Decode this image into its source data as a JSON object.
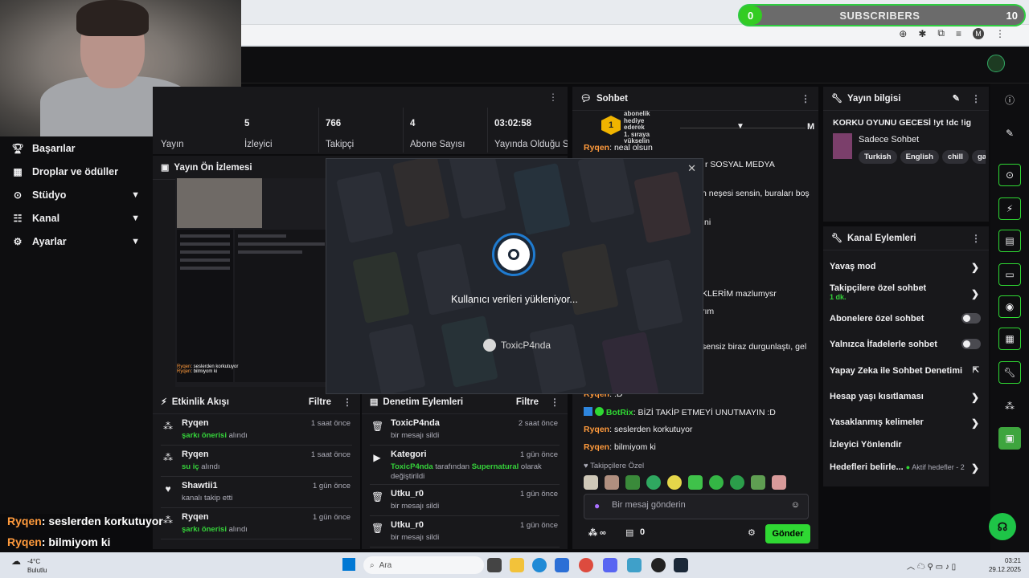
{
  "subscribers": {
    "current": "0",
    "label": "SUBSCRIBERS",
    "goal": "10",
    "progress_percent": 0,
    "accent": "#33cc22"
  },
  "sidebar": {
    "items": [
      {
        "label": "Başarılar",
        "icon": "trophy-icon",
        "chevron": false
      },
      {
        "label": "Droplar ve ödüller",
        "icon": "gift-icon",
        "chevron": false
      },
      {
        "label": "Stüdyo",
        "icon": "studio-icon",
        "chevron": true
      },
      {
        "label": "Kanal",
        "icon": "channel-icon",
        "chevron": true
      },
      {
        "label": "Ayarlar",
        "icon": "gear-icon",
        "chevron": true
      }
    ]
  },
  "stats": {
    "first_label": "Yayın",
    "items": [
      {
        "value": "5",
        "label": "İzleyici"
      },
      {
        "value": "766",
        "label": "Takipçi"
      },
      {
        "value": "4",
        "label": "Abone Sayısı"
      },
      {
        "value": "03:02:58",
        "label": "Yayında Olduğu Süre"
      }
    ]
  },
  "preview": {
    "title": "Yayın Ön İzlemesi"
  },
  "modal": {
    "loading_text": "Kullanıcı verileri yükleniyor...",
    "username": "ToxicP4nda"
  },
  "activity": {
    "title": "Etkinlik Akışı",
    "filter": "Filtre",
    "items": [
      {
        "icon": "bits-icon",
        "user": "Ryqen",
        "highlight": "şarkı önerisi",
        "rest": " alındı",
        "time": "1 saat önce"
      },
      {
        "icon": "bits-icon",
        "user": "Ryqen",
        "highlight": "su iç",
        "rest": " alındı",
        "time": "1 saat önce"
      },
      {
        "icon": "heart-icon",
        "user": "Shawtii1",
        "highlight": "",
        "rest": "kanalı takip etti",
        "time": "1 gün önce"
      },
      {
        "icon": "bits-icon",
        "user": "Ryqen",
        "highlight": "şarkı önerisi",
        "rest": " alındı",
        "time": "1 gün önce"
      }
    ]
  },
  "moderation": {
    "title": "Denetim Eylemleri",
    "filter": "Filtre",
    "items": [
      {
        "icon": "trash-icon",
        "user": "ToxicP4nda",
        "sub_a": "bir mesajı sildi",
        "time": "2 saat önce"
      },
      {
        "icon": "category-icon",
        "user": "Kategori",
        "sub_a": "ToxicP4nda",
        "sub_b": " tarafından ",
        "sub_c": "Supernatural",
        "sub_d": " olarak",
        "sub_e": "değiştirildi",
        "time": "1 gün önce"
      },
      {
        "icon": "trash-icon",
        "user": "Utku_r0",
        "sub_a": "bir mesajı sildi",
        "time": "1 gün önce"
      },
      {
        "icon": "trash-icon",
        "user": "Utku_r0",
        "sub_a": "bir mesajı sildi",
        "time": "1 gün önce"
      }
    ]
  },
  "chat": {
    "title": "Sohbet",
    "hype": {
      "rank": "1",
      "line1": "abonelik",
      "line2": "hediye",
      "line3": "ederek",
      "line4": "1. sıraya",
      "line5": "yükselin",
      "tier": "M"
    },
    "messages": [
      {
        "user": "Ryqen",
        "text": "neal olsun"
      },
      {
        "user": "Ryqen",
        "text": ":D"
      },
      {
        "user": "BotRix",
        "text": "BİZİ TAKİP ETMEYİ UNUTMAYIN :D"
      },
      {
        "user": "Ryqen",
        "text": "seslerden korkutuyor"
      },
      {
        "user": "Ryqen",
        "text": "bilmiyom ki"
      }
    ],
    "partial": [
      "r SOSYAL MEDYA",
      "n neşesi sensin, buraları boş",
      "ni",
      "KLERİM mazlumysr",
      "rım",
      "sensiz biraz durgunlaştı, gel"
    ],
    "followers_only": "Takipçilere Özel",
    "input_placeholder": "Bir mesaj gönderin",
    "points": "0",
    "send_label": "Gönder"
  },
  "stream_info": {
    "title": "Yayın bilgisi",
    "stream_title": "KORKU OYUNU GECESİ !yt !dc !ig",
    "category": "Sadece Sohbet",
    "tags": [
      "Turkish",
      "English",
      "chill",
      "gar"
    ]
  },
  "channel_actions": {
    "title": "Kanal Eylemleri",
    "items": [
      {
        "label": "Yavaş mod",
        "kind": "arrow"
      },
      {
        "label": "Takipçilere özel sohbet",
        "sub": "1 dk.",
        "kind": "arrow"
      },
      {
        "label": "Abonelere özel sohbet",
        "kind": "toggle"
      },
      {
        "label": "Yalnızca İfadelerle sohbet",
        "kind": "toggle"
      },
      {
        "label": "Yapay Zeka ile Sohbet Denetimi",
        "kind": "external"
      },
      {
        "label": "Hesap yaşı kısıtlaması",
        "kind": "arrow"
      },
      {
        "label": "Yasaklanmış kelimeler",
        "kind": "arrow"
      },
      {
        "label": "İzleyici Yönlendir",
        "kind": "none"
      },
      {
        "label": "Hedefleri belirle...",
        "sub": "Aktif hedefler - 2",
        "kind": "arrow"
      }
    ]
  },
  "overlay_chat": [
    {
      "user": "Ryqen",
      "text": ": seslerden korkutuyor"
    },
    {
      "user": "Ryqen",
      "text": ": bilmiyom ki"
    }
  ],
  "taskbar": {
    "temp": "-4°C",
    "weather": "Bulutlu",
    "search": "Ara",
    "time": "03:21",
    "date": "29.12.2025"
  }
}
